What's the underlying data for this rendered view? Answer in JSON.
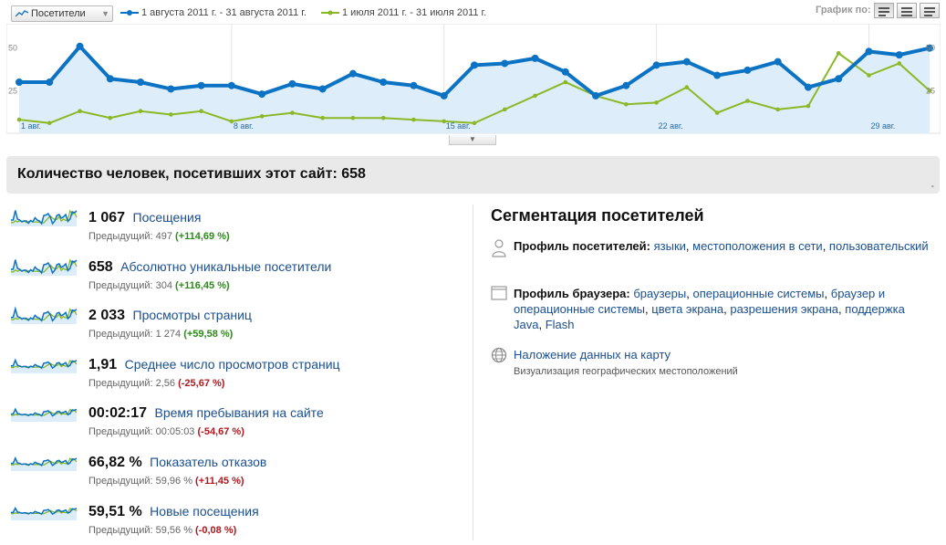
{
  "toolbar": {
    "metric_select": "Посетители",
    "legend_current": "1 августа 2011 г. - 31 августа 2011 г.",
    "legend_previous": "1 июля 2011 г. - 31 июля 2011 г.",
    "graph_by_label": "График по:",
    "colors": {
      "current": "#0b72c4",
      "previous": "#8bb826",
      "area_fill": "#ddeefa"
    }
  },
  "chart_data": {
    "type": "line",
    "y_ticks_left": [
      "50",
      "25"
    ],
    "y_ticks_right": [
      "50",
      "25"
    ],
    "ylim": [
      0,
      60
    ],
    "x_labels": [
      {
        "day": 1,
        "label": "1 авг."
      },
      {
        "day": 8,
        "label": "8 авг."
      },
      {
        "day": 15,
        "label": "15 авг."
      },
      {
        "day": 22,
        "label": "22 авг."
      },
      {
        "day": 29,
        "label": "29 авг."
      }
    ],
    "grid": "vertical-weekly",
    "series": [
      {
        "x": [
          1,
          2,
          3,
          4,
          5,
          6,
          7,
          8,
          9,
          10,
          11,
          12,
          13,
          14,
          15,
          16,
          17,
          18,
          19,
          20,
          21,
          22,
          23,
          24,
          25,
          26,
          27,
          28,
          29,
          30,
          31
        ],
        "values": [
          30,
          30,
          51,
          32,
          30,
          26,
          28,
          28,
          23,
          29,
          26,
          35,
          30,
          28,
          22,
          40,
          41,
          44,
          36,
          22,
          28,
          40,
          42,
          34,
          37,
          42,
          27,
          32,
          48,
          46,
          50
        ],
        "color": "#0b72c4"
      },
      {
        "x": [
          1,
          2,
          3,
          4,
          5,
          6,
          7,
          8,
          9,
          10,
          11,
          12,
          13,
          14,
          15,
          16,
          17,
          18,
          19,
          20,
          21,
          22,
          23,
          24,
          25,
          26,
          27,
          28,
          29,
          30,
          31
        ],
        "values": [
          8,
          6,
          13,
          9,
          13,
          11,
          13,
          7,
          10,
          12,
          9,
          9,
          9,
          8,
          7,
          6,
          14,
          22,
          30,
          22,
          17,
          18,
          27,
          12,
          19,
          14,
          16,
          47,
          34,
          41,
          25
        ],
        "color": "#8bb826"
      }
    ]
  },
  "summary": {
    "title": "Количество человек, посетивших этот сайт: 658"
  },
  "metrics": [
    {
      "value": "1 067",
      "label": "Посещения",
      "prev_label": "Предыдущий:",
      "prev_value": "497",
      "change": "(+114,69 %)",
      "dir": "pos"
    },
    {
      "value": "658",
      "label": "Абсолютно уникальные посетители",
      "prev_label": "Предыдущий:",
      "prev_value": "304",
      "change": "(+116,45 %)",
      "dir": "pos"
    },
    {
      "value": "2 033",
      "label": "Просмотры страниц",
      "prev_label": "Предыдущий:",
      "prev_value": "1 274",
      "change": "(+59,58 %)",
      "dir": "pos"
    },
    {
      "value": "1,91",
      "label": "Среднее число просмотров страниц",
      "prev_label": "Предыдущий:",
      "prev_value": "2,56",
      "change": "(-25,67 %)",
      "dir": "neg"
    },
    {
      "value": "00:02:17",
      "label": "Время пребывания на сайте",
      "prev_label": "Предыдущий:",
      "prev_value": "00:05:03",
      "change": "(-54,67 %)",
      "dir": "neg"
    },
    {
      "value": "66,82 %",
      "label": "Показатель отказов",
      "prev_label": "Предыдущий:",
      "prev_value": "59,96 %",
      "change": "(+11,45 %)",
      "dir": "neg"
    },
    {
      "value": "59,51 %",
      "label": "Новые посещения",
      "prev_label": "Предыдущий:",
      "prev_value": "59,56 %",
      "change": "(-0,08 %)",
      "dir": "neg"
    }
  ],
  "segmentation": {
    "title": "Сегментация посетителей",
    "visitors_profile": {
      "label": "Профиль посетителей:",
      "links": [
        "языки",
        "местоположения в сети",
        "пользовательский"
      ],
      "icon": "person-icon"
    },
    "browser_profile": {
      "label": "Профиль браузера:",
      "links": [
        "браузеры",
        "операционные системы",
        "браузер и операционные системы",
        "цвета экрана",
        "разрешения экрана",
        "поддержка Java",
        "Flash"
      ],
      "icon": "browser-window-icon"
    },
    "map_overlay": {
      "link": "Наложение данных на карту",
      "description": "Визуализация географических местоположений",
      "icon": "globe-icon"
    }
  }
}
